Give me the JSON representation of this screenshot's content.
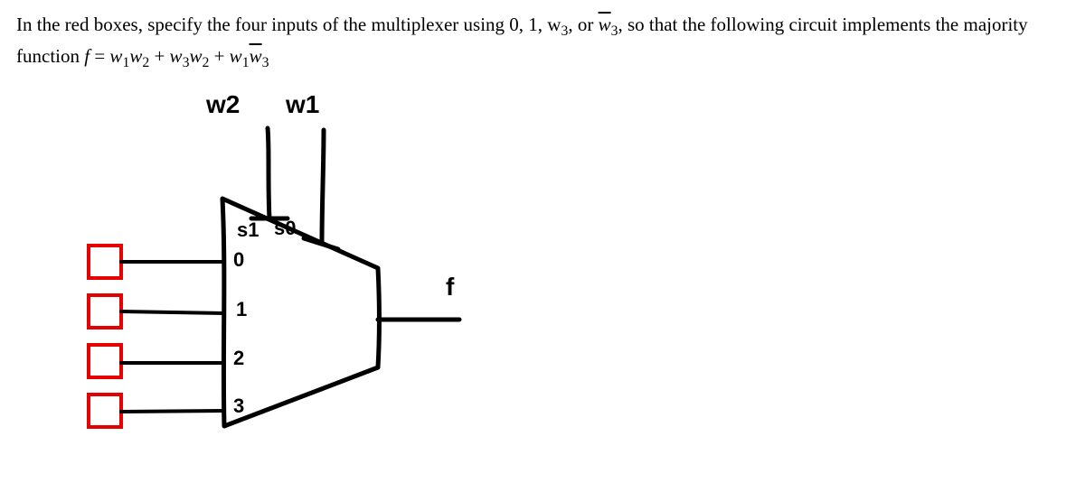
{
  "question": {
    "intro": "In the red boxes, specify the four inputs of the multiplexer using 0, 1, w",
    "sub_3a": "3",
    "comma_or": ", or ",
    "wbar": "w",
    "sub_3b": "3",
    "so_that": ", so that the following circuit implements the majority function ",
    "f_eq": "f",
    "eq": " = ",
    "t1a": "w",
    "t1a_sub": "1",
    "t1b": "w",
    "t1b_sub": "2",
    "plus1": " + ",
    "t2a": "w",
    "t2a_sub": "3",
    "t2b": "w",
    "t2b_sub": "2",
    "plus2": " + ",
    "t3a": "w",
    "t3a_sub": "1",
    "t3b": "w",
    "t3b_sub": "3"
  },
  "labels": {
    "sel1": "w",
    "sel1_sub": "2",
    "sel0": "w",
    "sel0_sub": "1",
    "s1": "s",
    "s1_sub": "1",
    "s0": "s",
    "s0_sub": "0",
    "in0": "0",
    "in1": "1",
    "in2": "2",
    "in3": "3",
    "out": "f"
  }
}
